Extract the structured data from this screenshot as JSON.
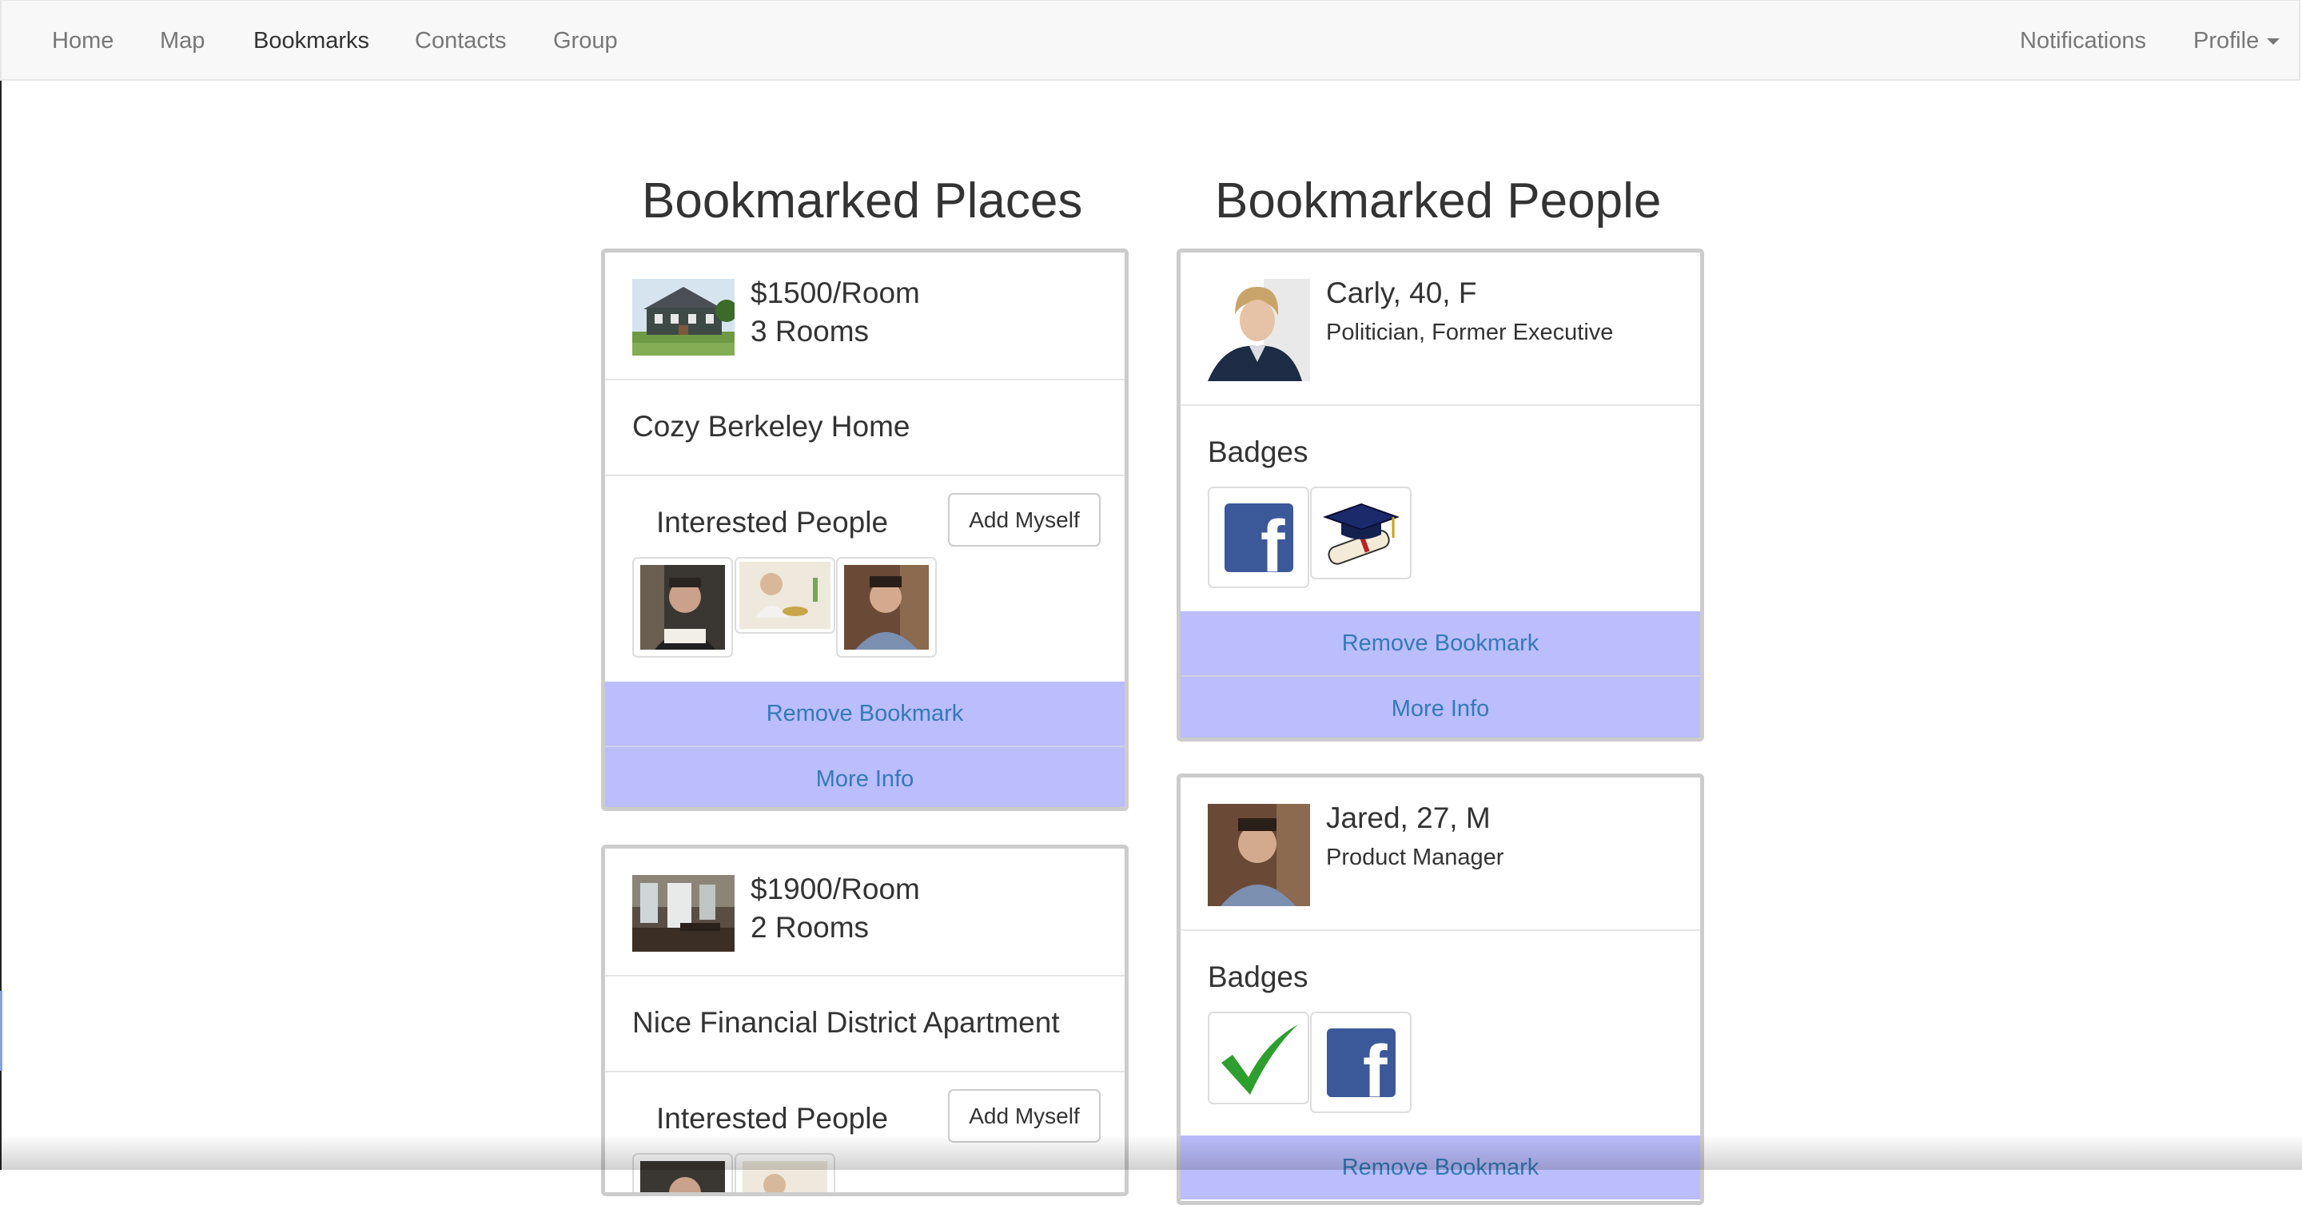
{
  "nav": {
    "left": [
      "Home",
      "Map",
      "Bookmarks",
      "Contacts",
      "Group"
    ],
    "right": [
      "Notifications",
      "Profile"
    ],
    "active": "Bookmarks"
  },
  "places": {
    "heading": "Bookmarked Places",
    "interested_label": "Interested People",
    "add_label": "Add Myself",
    "remove_label": "Remove Bookmark",
    "more_label": "More Info",
    "items": [
      {
        "price": "$1500/Room",
        "rooms": "3 Rooms",
        "name": "Cozy Berkeley Home"
      },
      {
        "price": "$1900/Room",
        "rooms": "2 Rooms",
        "name": "Nice Financial District Apartment"
      }
    ]
  },
  "people": {
    "heading": "Bookmarked People",
    "badges_label": "Badges",
    "remove_label": "Remove Bookmark",
    "more_label": "More Info",
    "items": [
      {
        "name": "Carly, 40, F",
        "job": "Politician, Former Executive",
        "badges": [
          "facebook-badge",
          "graduation-badge"
        ]
      },
      {
        "name": "Jared, 27, M",
        "job": "Product Manager",
        "badges": [
          "verified-badge",
          "facebook-badge"
        ]
      }
    ]
  },
  "colors": {
    "action_bg": "#bbbdfc",
    "action_text": "#337ab7",
    "facebook": "#3b5998",
    "check": "#2e9e2e"
  }
}
